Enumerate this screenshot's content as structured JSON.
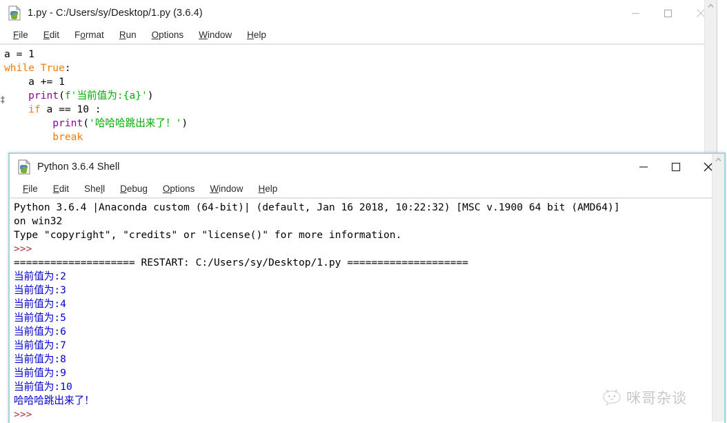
{
  "editor_window": {
    "title": "1.py - C:/Users/sy/Desktop/1.py (3.6.4)",
    "icon": "python-idle-icon",
    "controls": {
      "minimize": "—",
      "maximize": "□",
      "close": "✕"
    },
    "menus": [
      {
        "label": "File",
        "mnemonic": "F",
        "rest": "ile"
      },
      {
        "label": "Edit",
        "mnemonic": "E",
        "rest": "dit"
      },
      {
        "label": "Format",
        "pre": "F",
        "mnemonic": "o",
        "rest": "rmat"
      },
      {
        "label": "Run",
        "mnemonic": "R",
        "rest": "un"
      },
      {
        "label": "Options",
        "mnemonic": "O",
        "rest": "ptions"
      },
      {
        "label": "Window",
        "mnemonic": "W",
        "rest": "indow"
      },
      {
        "label": "Help",
        "mnemonic": "H",
        "rest": "elp"
      }
    ],
    "code_lines": [
      [
        {
          "t": "a = 1",
          "c": "tok-default"
        }
      ],
      [
        {
          "t": "while",
          "c": "tok-keyword"
        },
        {
          "t": " ",
          "c": "tok-default"
        },
        {
          "t": "True",
          "c": "tok-keyword"
        },
        {
          "t": ":",
          "c": "tok-default"
        }
      ],
      [
        {
          "t": "    a += 1",
          "c": "tok-default"
        }
      ],
      [
        {
          "t": "    ",
          "c": "tok-default"
        },
        {
          "t": "print",
          "c": "tok-builtin"
        },
        {
          "t": "(",
          "c": "tok-default"
        },
        {
          "t": "f'当前值为:{a}'",
          "c": "tok-string"
        },
        {
          "t": ")",
          "c": "tok-default"
        }
      ],
      [
        {
          "t": "    ",
          "c": "tok-default"
        },
        {
          "t": "if",
          "c": "tok-keyword"
        },
        {
          "t": " a == 10 :",
          "c": "tok-default"
        }
      ],
      [
        {
          "t": "        ",
          "c": "tok-default"
        },
        {
          "t": "print",
          "c": "tok-builtin"
        },
        {
          "t": "(",
          "c": "tok-default"
        },
        {
          "t": "'哈哈哈跳出来了！'",
          "c": "tok-string"
        },
        {
          "t": ")",
          "c": "tok-default"
        }
      ],
      [
        {
          "t": "        ",
          "c": "tok-default"
        },
        {
          "t": "break",
          "c": "tok-keyword"
        }
      ]
    ],
    "stray_glyph": "‡"
  },
  "shell_window": {
    "title": "Python 3.6.4 Shell",
    "icon": "python-idle-icon",
    "controls": {
      "minimize": "—",
      "maximize": "□",
      "close": "✕"
    },
    "menus": [
      {
        "label": "File",
        "mnemonic": "F",
        "rest": "ile"
      },
      {
        "label": "Edit",
        "mnemonic": "E",
        "rest": "dit"
      },
      {
        "label": "Shell",
        "pre": "She",
        "mnemonic": "l",
        "rest": "l"
      },
      {
        "label": "Debug",
        "mnemonic": "D",
        "rest": "ebug"
      },
      {
        "label": "Options",
        "mnemonic": "O",
        "rest": "ptions"
      },
      {
        "label": "Window",
        "mnemonic": "W",
        "rest": "indow"
      },
      {
        "label": "Help",
        "mnemonic": "H",
        "rest": "elp"
      }
    ],
    "output_lines": [
      [
        {
          "t": "Python 3.6.4 |Anaconda custom (64-bit)| (default, Jan 16 2018, 10:22:32) [MSC v.1900 64 bit (AMD64)]",
          "c": "tok-default"
        }
      ],
      [
        {
          "t": "on win32",
          "c": "tok-default"
        }
      ],
      [
        {
          "t": "Type \"copyright\", \"credits\" or \"license()\" for more information.",
          "c": "tok-default"
        }
      ],
      [
        {
          "t": ">>> ",
          "c": "out-prompt"
        }
      ],
      [
        {
          "t": "==================== RESTART: C:/Users/sy/Desktop/1.py ====================",
          "c": "tok-default"
        }
      ],
      [
        {
          "t": "当前值为:2",
          "c": "out-stdout"
        }
      ],
      [
        {
          "t": "当前值为:3",
          "c": "out-stdout"
        }
      ],
      [
        {
          "t": "当前值为:4",
          "c": "out-stdout"
        }
      ],
      [
        {
          "t": "当前值为:5",
          "c": "out-stdout"
        }
      ],
      [
        {
          "t": "当前值为:6",
          "c": "out-stdout"
        }
      ],
      [
        {
          "t": "当前值为:7",
          "c": "out-stdout"
        }
      ],
      [
        {
          "t": "当前值为:8",
          "c": "out-stdout"
        }
      ],
      [
        {
          "t": "当前值为:9",
          "c": "out-stdout"
        }
      ],
      [
        {
          "t": "当前值为:10",
          "c": "out-stdout"
        }
      ],
      [
        {
          "t": "哈哈哈跳出来了！",
          "c": "out-stdout"
        }
      ],
      [
        {
          "t": ">>> ",
          "c": "out-prompt"
        }
      ]
    ]
  },
  "watermark": {
    "text": "咪哥杂谈",
    "icon": "chat-bubble-cat-icon"
  },
  "colors": {
    "keyword": "#ff7700",
    "builtin": "#900090",
    "string": "#00aa00",
    "stdout": "#0000cc",
    "prompt": "#aa3333",
    "active_window_border": "#9fd7e0"
  }
}
